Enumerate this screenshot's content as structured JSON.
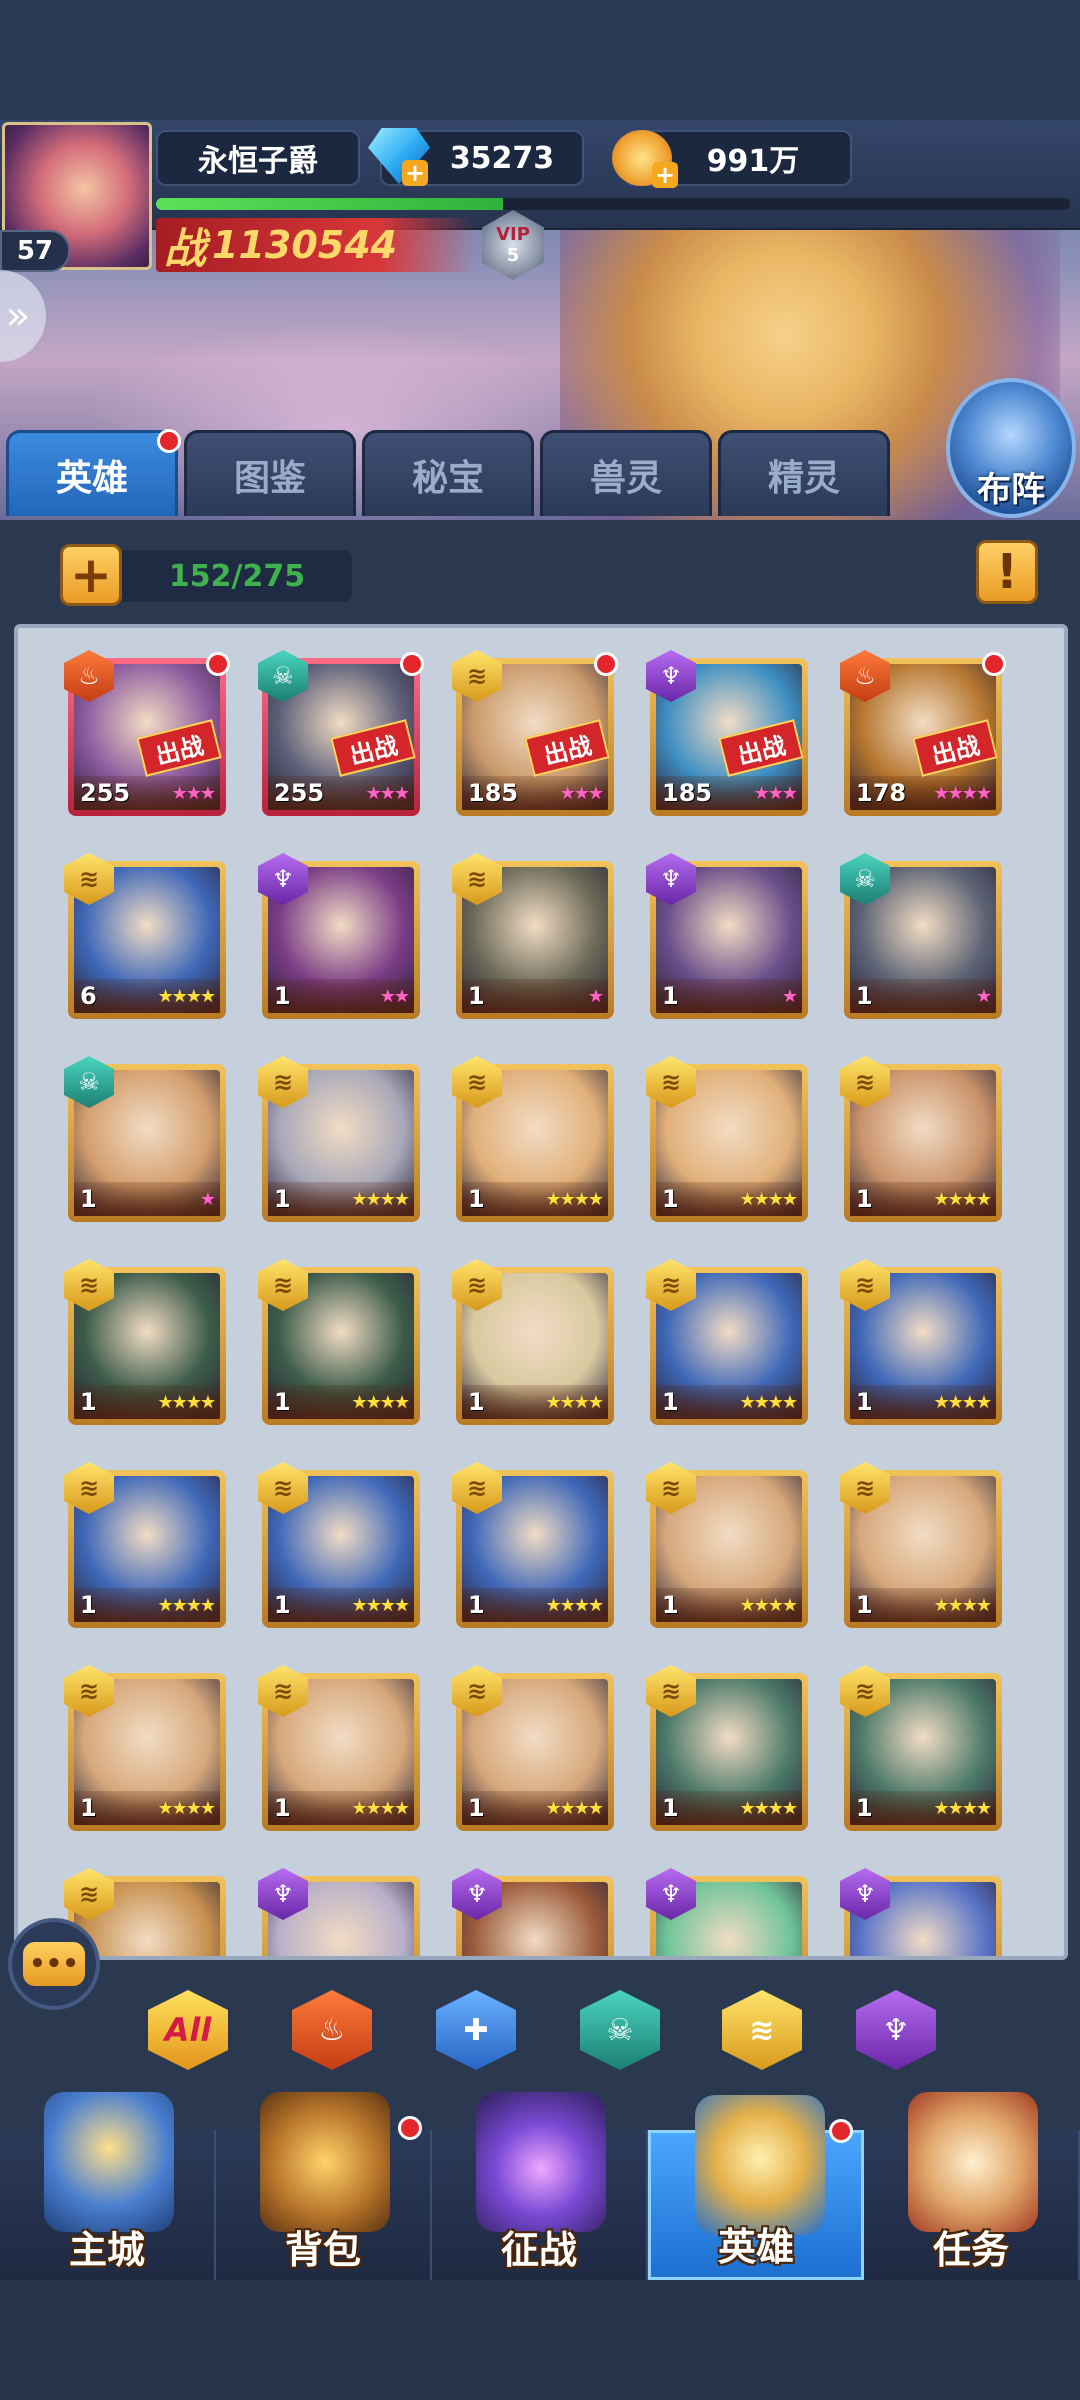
{
  "player": {
    "level": "57",
    "title": "永恒子爵",
    "gems": "35273",
    "gold": "991万",
    "power_prefix": "战",
    "power": "1130544",
    "vip_label": "VIP",
    "vip_level": "5",
    "exp_fraction": 0.38
  },
  "tabs": [
    {
      "label": "英雄",
      "active": true,
      "badge": true
    },
    {
      "label": "图鉴",
      "active": false,
      "badge": false
    },
    {
      "label": "秘宝",
      "active": false,
      "badge": false
    },
    {
      "label": "兽灵",
      "active": false,
      "badge": false
    },
    {
      "label": "精灵",
      "active": false,
      "badge": false
    }
  ],
  "formation_label": "布阵",
  "hero_count": "152/275",
  "info_symbol": "!",
  "add_symbol": "+",
  "deploy_tag": "出战",
  "heroes": [
    {
      "level": "255",
      "stars": 3,
      "star_color": "pink",
      "faction": "fire",
      "frame": "red",
      "deployed": true,
      "badge": true,
      "art": "#8d5a9e"
    },
    {
      "level": "255",
      "stars": 3,
      "star_color": "pink",
      "faction": "death",
      "frame": "red",
      "deployed": true,
      "badge": true,
      "art": "#5c5f78"
    },
    {
      "level": "185",
      "stars": 3,
      "star_color": "pink",
      "faction": "wind",
      "frame": "gold",
      "deployed": true,
      "badge": true,
      "art": "#c99a6b"
    },
    {
      "level": "185",
      "stars": 3,
      "star_color": "pink",
      "faction": "dark",
      "frame": "gold",
      "deployed": true,
      "badge": false,
      "art": "#3e8fc2"
    },
    {
      "level": "178",
      "stars": 4,
      "star_color": "pink",
      "faction": "fire",
      "frame": "gold",
      "deployed": true,
      "badge": true,
      "art": "#b5762f"
    },
    {
      "level": "6",
      "stars": 4,
      "star_color": "gold",
      "faction": "wind",
      "frame": "gold",
      "deployed": false,
      "badge": false,
      "art": "#3f68b8"
    },
    {
      "level": "1",
      "stars": 2,
      "star_color": "pink",
      "faction": "dark",
      "frame": "gold",
      "deployed": false,
      "badge": false,
      "art": "#7a3d86"
    },
    {
      "level": "1",
      "stars": 1,
      "star_color": "pink",
      "faction": "wind",
      "frame": "gold",
      "deployed": false,
      "badge": false,
      "art": "#6b6a58"
    },
    {
      "level": "1",
      "stars": 1,
      "star_color": "pink",
      "faction": "dark",
      "frame": "gold",
      "deployed": false,
      "badge": false,
      "art": "#6a4f8a"
    },
    {
      "level": "1",
      "stars": 1,
      "star_color": "pink",
      "faction": "death",
      "frame": "gold",
      "deployed": false,
      "badge": false,
      "art": "#5d6475"
    },
    {
      "level": "1",
      "stars": 1,
      "star_color": "pink",
      "faction": "death",
      "frame": "gold",
      "deployed": false,
      "badge": false,
      "art": "#d39e6e"
    },
    {
      "level": "1",
      "stars": 4,
      "star_color": "gold",
      "faction": "wind",
      "frame": "gold",
      "deployed": false,
      "badge": false,
      "art": "#a8a8b8"
    },
    {
      "level": "1",
      "stars": 4,
      "star_color": "gold",
      "faction": "wind",
      "frame": "gold",
      "deployed": false,
      "badge": false,
      "art": "#e1b07a"
    },
    {
      "level": "1",
      "stars": 4,
      "star_color": "gold",
      "faction": "wind",
      "frame": "gold",
      "deployed": false,
      "badge": false,
      "art": "#e1b07a"
    },
    {
      "level": "1",
      "stars": 4,
      "star_color": "gold",
      "faction": "wind",
      "frame": "gold",
      "deployed": false,
      "badge": false,
      "art": "#c9936b"
    },
    {
      "level": "1",
      "stars": 4,
      "star_color": "gold",
      "faction": "wind",
      "frame": "gold",
      "deployed": false,
      "badge": false,
      "art": "#3c5c4a"
    },
    {
      "level": "1",
      "stars": 4,
      "star_color": "gold",
      "faction": "wind",
      "frame": "gold",
      "deployed": false,
      "badge": false,
      "art": "#3c5c4a"
    },
    {
      "level": "1",
      "stars": 4,
      "star_color": "gold",
      "faction": "wind",
      "frame": "gold",
      "deployed": false,
      "badge": false,
      "art": "#d8c9a0"
    },
    {
      "level": "1",
      "stars": 4,
      "star_color": "gold",
      "faction": "wind",
      "frame": "gold",
      "deployed": false,
      "badge": false,
      "art": "#3f68b8"
    },
    {
      "level": "1",
      "stars": 4,
      "star_color": "gold",
      "faction": "wind",
      "frame": "gold",
      "deployed": false,
      "badge": false,
      "art": "#3f68b8"
    },
    {
      "level": "1",
      "stars": 4,
      "star_color": "gold",
      "faction": "wind",
      "frame": "gold",
      "deployed": false,
      "badge": false,
      "art": "#3f68b8"
    },
    {
      "level": "1",
      "stars": 4,
      "star_color": "gold",
      "faction": "wind",
      "frame": "gold",
      "deployed": false,
      "badge": false,
      "art": "#3f68b8"
    },
    {
      "level": "1",
      "stars": 4,
      "star_color": "gold",
      "faction": "wind",
      "frame": "gold",
      "deployed": false,
      "badge": false,
      "art": "#3f68b8"
    },
    {
      "level": "1",
      "stars": 4,
      "star_color": "gold",
      "faction": "wind",
      "frame": "gold",
      "deployed": false,
      "badge": false,
      "art": "#d6a87c"
    },
    {
      "level": "1",
      "stars": 4,
      "star_color": "gold",
      "faction": "wind",
      "frame": "gold",
      "deployed": false,
      "badge": false,
      "art": "#d6a87c"
    },
    {
      "level": "1",
      "stars": 4,
      "star_color": "gold",
      "faction": "wind",
      "frame": "gold",
      "deployed": false,
      "badge": false,
      "art": "#d6a87c"
    },
    {
      "level": "1",
      "stars": 4,
      "star_color": "gold",
      "faction": "wind",
      "frame": "gold",
      "deployed": false,
      "badge": false,
      "art": "#d6a87c"
    },
    {
      "level": "1",
      "stars": 4,
      "star_color": "gold",
      "faction": "wind",
      "frame": "gold",
      "deployed": false,
      "badge": false,
      "art": "#d6a87c"
    },
    {
      "level": "1",
      "stars": 4,
      "star_color": "gold",
      "faction": "wind",
      "frame": "gold",
      "deployed": false,
      "badge": false,
      "art": "#4d7a6a"
    },
    {
      "level": "1",
      "stars": 4,
      "star_color": "gold",
      "faction": "wind",
      "frame": "gold",
      "deployed": false,
      "badge": false,
      "art": "#4d7a6a"
    },
    {
      "level": "",
      "stars": 0,
      "star_color": "gold",
      "faction": "wind",
      "frame": "gold",
      "deployed": false,
      "badge": false,
      "art": "#c68f4e"
    },
    {
      "level": "",
      "stars": 0,
      "star_color": "gold",
      "faction": "dark",
      "frame": "gold",
      "deployed": false,
      "badge": false,
      "art": "#b8b0c8"
    },
    {
      "level": "",
      "stars": 0,
      "star_color": "gold",
      "faction": "dark",
      "frame": "gold",
      "deployed": false,
      "badge": false,
      "art": "#9a5a3a"
    },
    {
      "level": "",
      "stars": 0,
      "star_color": "gold",
      "faction": "dark",
      "frame": "gold",
      "deployed": false,
      "badge": false,
      "art": "#6fc49a"
    },
    {
      "level": "",
      "stars": 0,
      "star_color": "gold",
      "faction": "dark",
      "frame": "gold",
      "deployed": false,
      "badge": false,
      "art": "#5a74c8"
    }
  ],
  "filters": [
    {
      "name": "all",
      "label": "All"
    },
    {
      "name": "fire",
      "label": ""
    },
    {
      "name": "holy",
      "label": ""
    },
    {
      "name": "death",
      "label": ""
    },
    {
      "name": "wind",
      "label": ""
    },
    {
      "name": "dark",
      "label": ""
    }
  ],
  "chat_icon": "chat-icon",
  "nav": [
    {
      "label": "主城",
      "active": false,
      "badge": false,
      "icon": "castle-icon"
    },
    {
      "label": "背包",
      "active": false,
      "badge": true,
      "icon": "chest-icon"
    },
    {
      "label": "征战",
      "active": false,
      "badge": false,
      "icon": "portal-icon"
    },
    {
      "label": "英雄",
      "active": true,
      "badge": true,
      "icon": "helmet-icon"
    },
    {
      "label": "任务",
      "active": false,
      "badge": false,
      "icon": "scroll-icon"
    }
  ],
  "colors": {
    "accent": "#2f7fe0",
    "gold": "#f2c35a",
    "alert": "#e2262b",
    "count_text": "#3fb24d"
  }
}
